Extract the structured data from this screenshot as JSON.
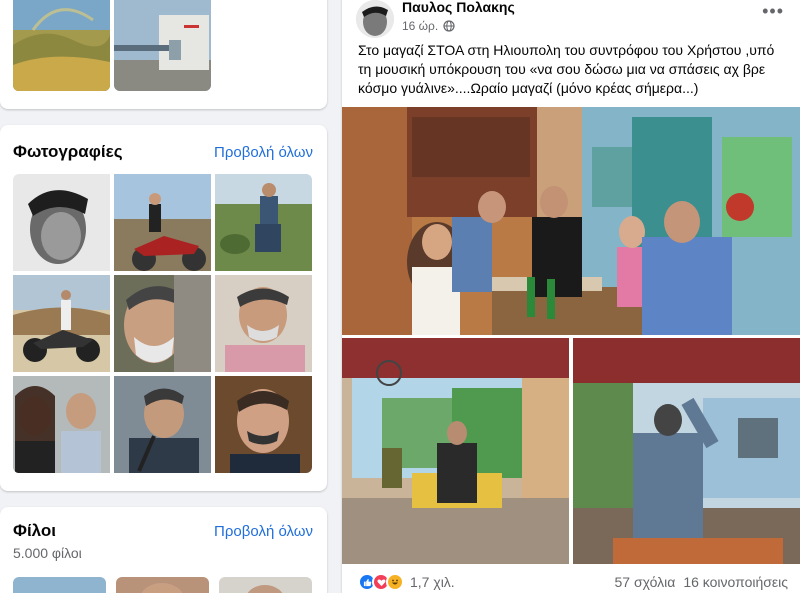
{
  "photos_section": {
    "title": "Φωτογραφίες",
    "see_all": "Προβολή όλων"
  },
  "friends_section": {
    "title": "Φίλοι",
    "see_all": "Προβολή όλων",
    "count": "5.000 φίλοι"
  },
  "post": {
    "author": "Παυλος Πολακης",
    "time": "16 ώρ.",
    "privacy_icon": "globe-icon",
    "text": "Στο μαγαζί ΣΤΟΑ στη Ηλιουπολη του συντρόφου του Χρήστου ,υπό τη μουσική υπόκρουση του «να σου δώσω μια να σπάσεις αχ βρε κόσμο γυάλινε»....Ωραίο μαγαζί (μόνο κρέας σήμερα...)",
    "reaction_count": "1,7 χιλ.",
    "comments": "57 σχόλια",
    "shares": "16 κοινοποιήσεις"
  },
  "colors": {
    "link": "#216fdb",
    "like": "#1877f2",
    "love": "#f33e58",
    "haha": "#f7b125"
  }
}
